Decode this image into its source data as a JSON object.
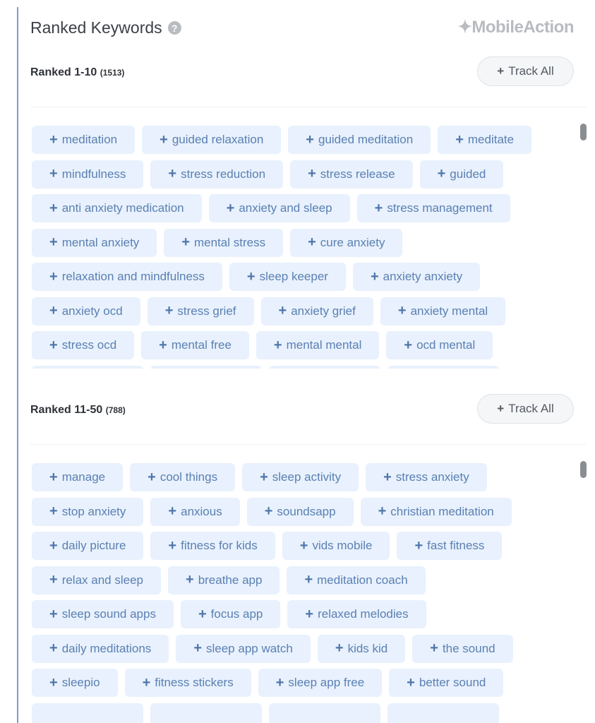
{
  "header": {
    "title": "Ranked Keywords",
    "help_icon": "question-circle-icon",
    "logo": "MobileAction"
  },
  "sections": [
    {
      "label": "Ranked 1-10",
      "count": "(1513)",
      "track_all": "Track All",
      "keywords": [
        "meditation",
        "guided relaxation",
        "guided meditation",
        "meditate",
        "mindfulness",
        "stress reduction",
        "stress release",
        "guided",
        "anti anxiety medication",
        "anxiety and sleep",
        "stress management",
        "mental anxiety",
        "mental stress",
        "cure anxiety",
        "relaxation and mindfulness",
        "sleep keeper",
        "anxiety anxiety",
        "anxiety ocd",
        "stress grief",
        "anxiety grief",
        "anxiety mental",
        "stress ocd",
        "mental free",
        "mental mental",
        "ocd mental"
      ]
    },
    {
      "label": "Ranked 11-50",
      "count": "(788)",
      "track_all": "Track All",
      "keywords": [
        "manage",
        "cool things",
        "sleep activity",
        "stress anxiety",
        "stop anxiety",
        "anxious",
        "soundsapp",
        "christian meditation",
        "daily picture",
        "fitness for kids",
        "vids mobile",
        "fast fitness",
        "relax and sleep",
        "breathe app",
        "meditation coach",
        "sleep sound apps",
        "focus app",
        "relaxed melodies",
        "daily meditations",
        "sleep app watch",
        "kids kid",
        "the sound",
        "sleepio",
        "fitness stickers",
        "sleep app free",
        "better sound"
      ]
    }
  ],
  "colors": {
    "chip_bg": "#e8f1fd",
    "chip_text": "#5b80b2",
    "accent_bar": "#7b9bc9"
  }
}
